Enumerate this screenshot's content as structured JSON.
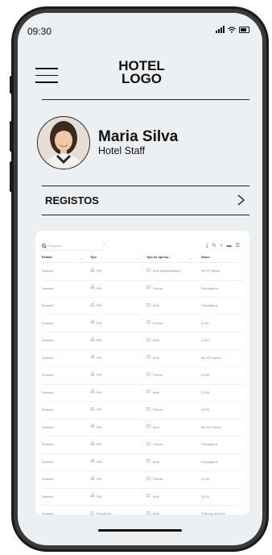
{
  "status_bar": {
    "time": "09:30"
  },
  "header": {
    "logo_line1": "HOTEL",
    "logo_line2": "LOGO"
  },
  "profile": {
    "name": "Maria Silva",
    "role": "Hotel Staff"
  },
  "section": {
    "label": "REGISTOS"
  },
  "table": {
    "search_placeholder": "Pesquisar",
    "columns": [
      "Estado",
      "Tipo",
      "Tipo de operaç...",
      "Nome"
    ],
    "rows": [
      {
        "estado": "Sucesso",
        "tipo": "PIN",
        "operacao": "Abrir (Administrador)",
        "nome": "MS PI Interior"
      },
      {
        "estado": "Sucesso",
        "tipo": "PIN",
        "operacao": "Fechar",
        "nome": "P.avrsqsens"
      },
      {
        "estado": "Sucesso",
        "tipo": "PIN",
        "operacao": "Abrir",
        "nome": "P.avrsqsens"
      },
      {
        "estado": "Sucesso",
        "tipo": "PIN",
        "operacao": "Fechar",
        "nome": "Q.207"
      },
      {
        "estado": "Sucesso",
        "tipo": "PIN",
        "operacao": "Abrir",
        "nome": "Q.207"
      },
      {
        "estado": "Sucesso",
        "tipo": "PIN",
        "operacao": "Abrir",
        "nome": "MS PD Interior"
      },
      {
        "estado": "Sucesso",
        "tipo": "PIN",
        "operacao": "Fechar",
        "nome": "Q.206"
      },
      {
        "estado": "Sucesso",
        "tipo": "PIN",
        "operacao": "Abrir",
        "nome": "Q.206"
      },
      {
        "estado": "Sucesso",
        "tipo": "PIN",
        "operacao": "Fechar",
        "nome": "Q.206"
      },
      {
        "estado": "Sucesso",
        "tipo": "PIN",
        "operacao": "Abrir",
        "nome": "MS PD Interior"
      },
      {
        "estado": "Sucesso",
        "tipo": "PIN",
        "operacao": "Fechar",
        "nome": "P.avrsqsens"
      },
      {
        "estado": "Sucesso",
        "tipo": "PIN",
        "operacao": "Abrir",
        "nome": "P.avrsqsens"
      },
      {
        "estado": "Sucesso",
        "tipo": "PIN",
        "operacao": "Fechar",
        "nome": "Q.210"
      },
      {
        "estado": "Sucesso",
        "tipo": "PIN",
        "operacao": "Abrir",
        "nome": "Q.210"
      },
      {
        "estado": "Sucesso",
        "tipo": "Fechadura",
        "operacao": "Abrir",
        "nome": "P.Serviço Exterior"
      }
    ]
  },
  "colors": {
    "screen_bg": "#edf0f3",
    "card_bg": "#ffffff",
    "text": "#111111"
  }
}
